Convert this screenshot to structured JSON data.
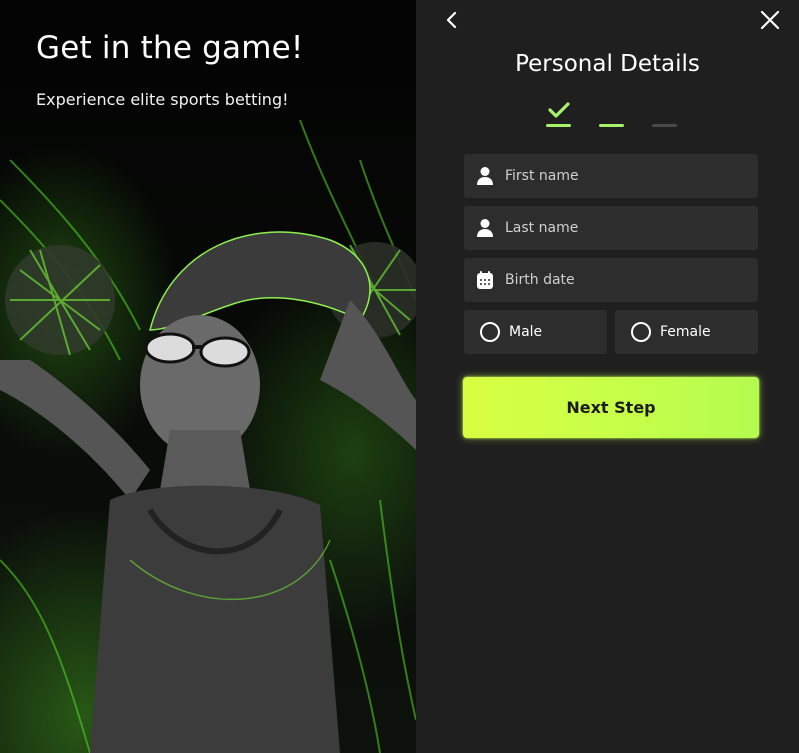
{
  "hero": {
    "title": "Get in the game!",
    "subtitle": "Experience elite sports betting!"
  },
  "form": {
    "title": "Personal Details",
    "steps": {
      "completed": 1,
      "current": 2,
      "total": 3
    },
    "first_name": {
      "placeholder": "First name",
      "value": ""
    },
    "last_name": {
      "placeholder": "Last name",
      "value": ""
    },
    "birth_date": {
      "placeholder": "Birth date",
      "value": ""
    },
    "gender": {
      "options": [
        "Male",
        "Female"
      ],
      "selected": ""
    },
    "next_label": "Next Step"
  },
  "icons": {
    "back": "chevron-left-icon",
    "close": "close-icon",
    "user": "user-icon",
    "calendar": "calendar-icon",
    "check": "check-icon"
  },
  "colors": {
    "accent": "#a6f26a",
    "button_gradient_start": "#d8ff42",
    "button_gradient_end": "#b4fb50",
    "panel_bg": "#1f1f1f",
    "field_bg": "#2d2d2d"
  }
}
